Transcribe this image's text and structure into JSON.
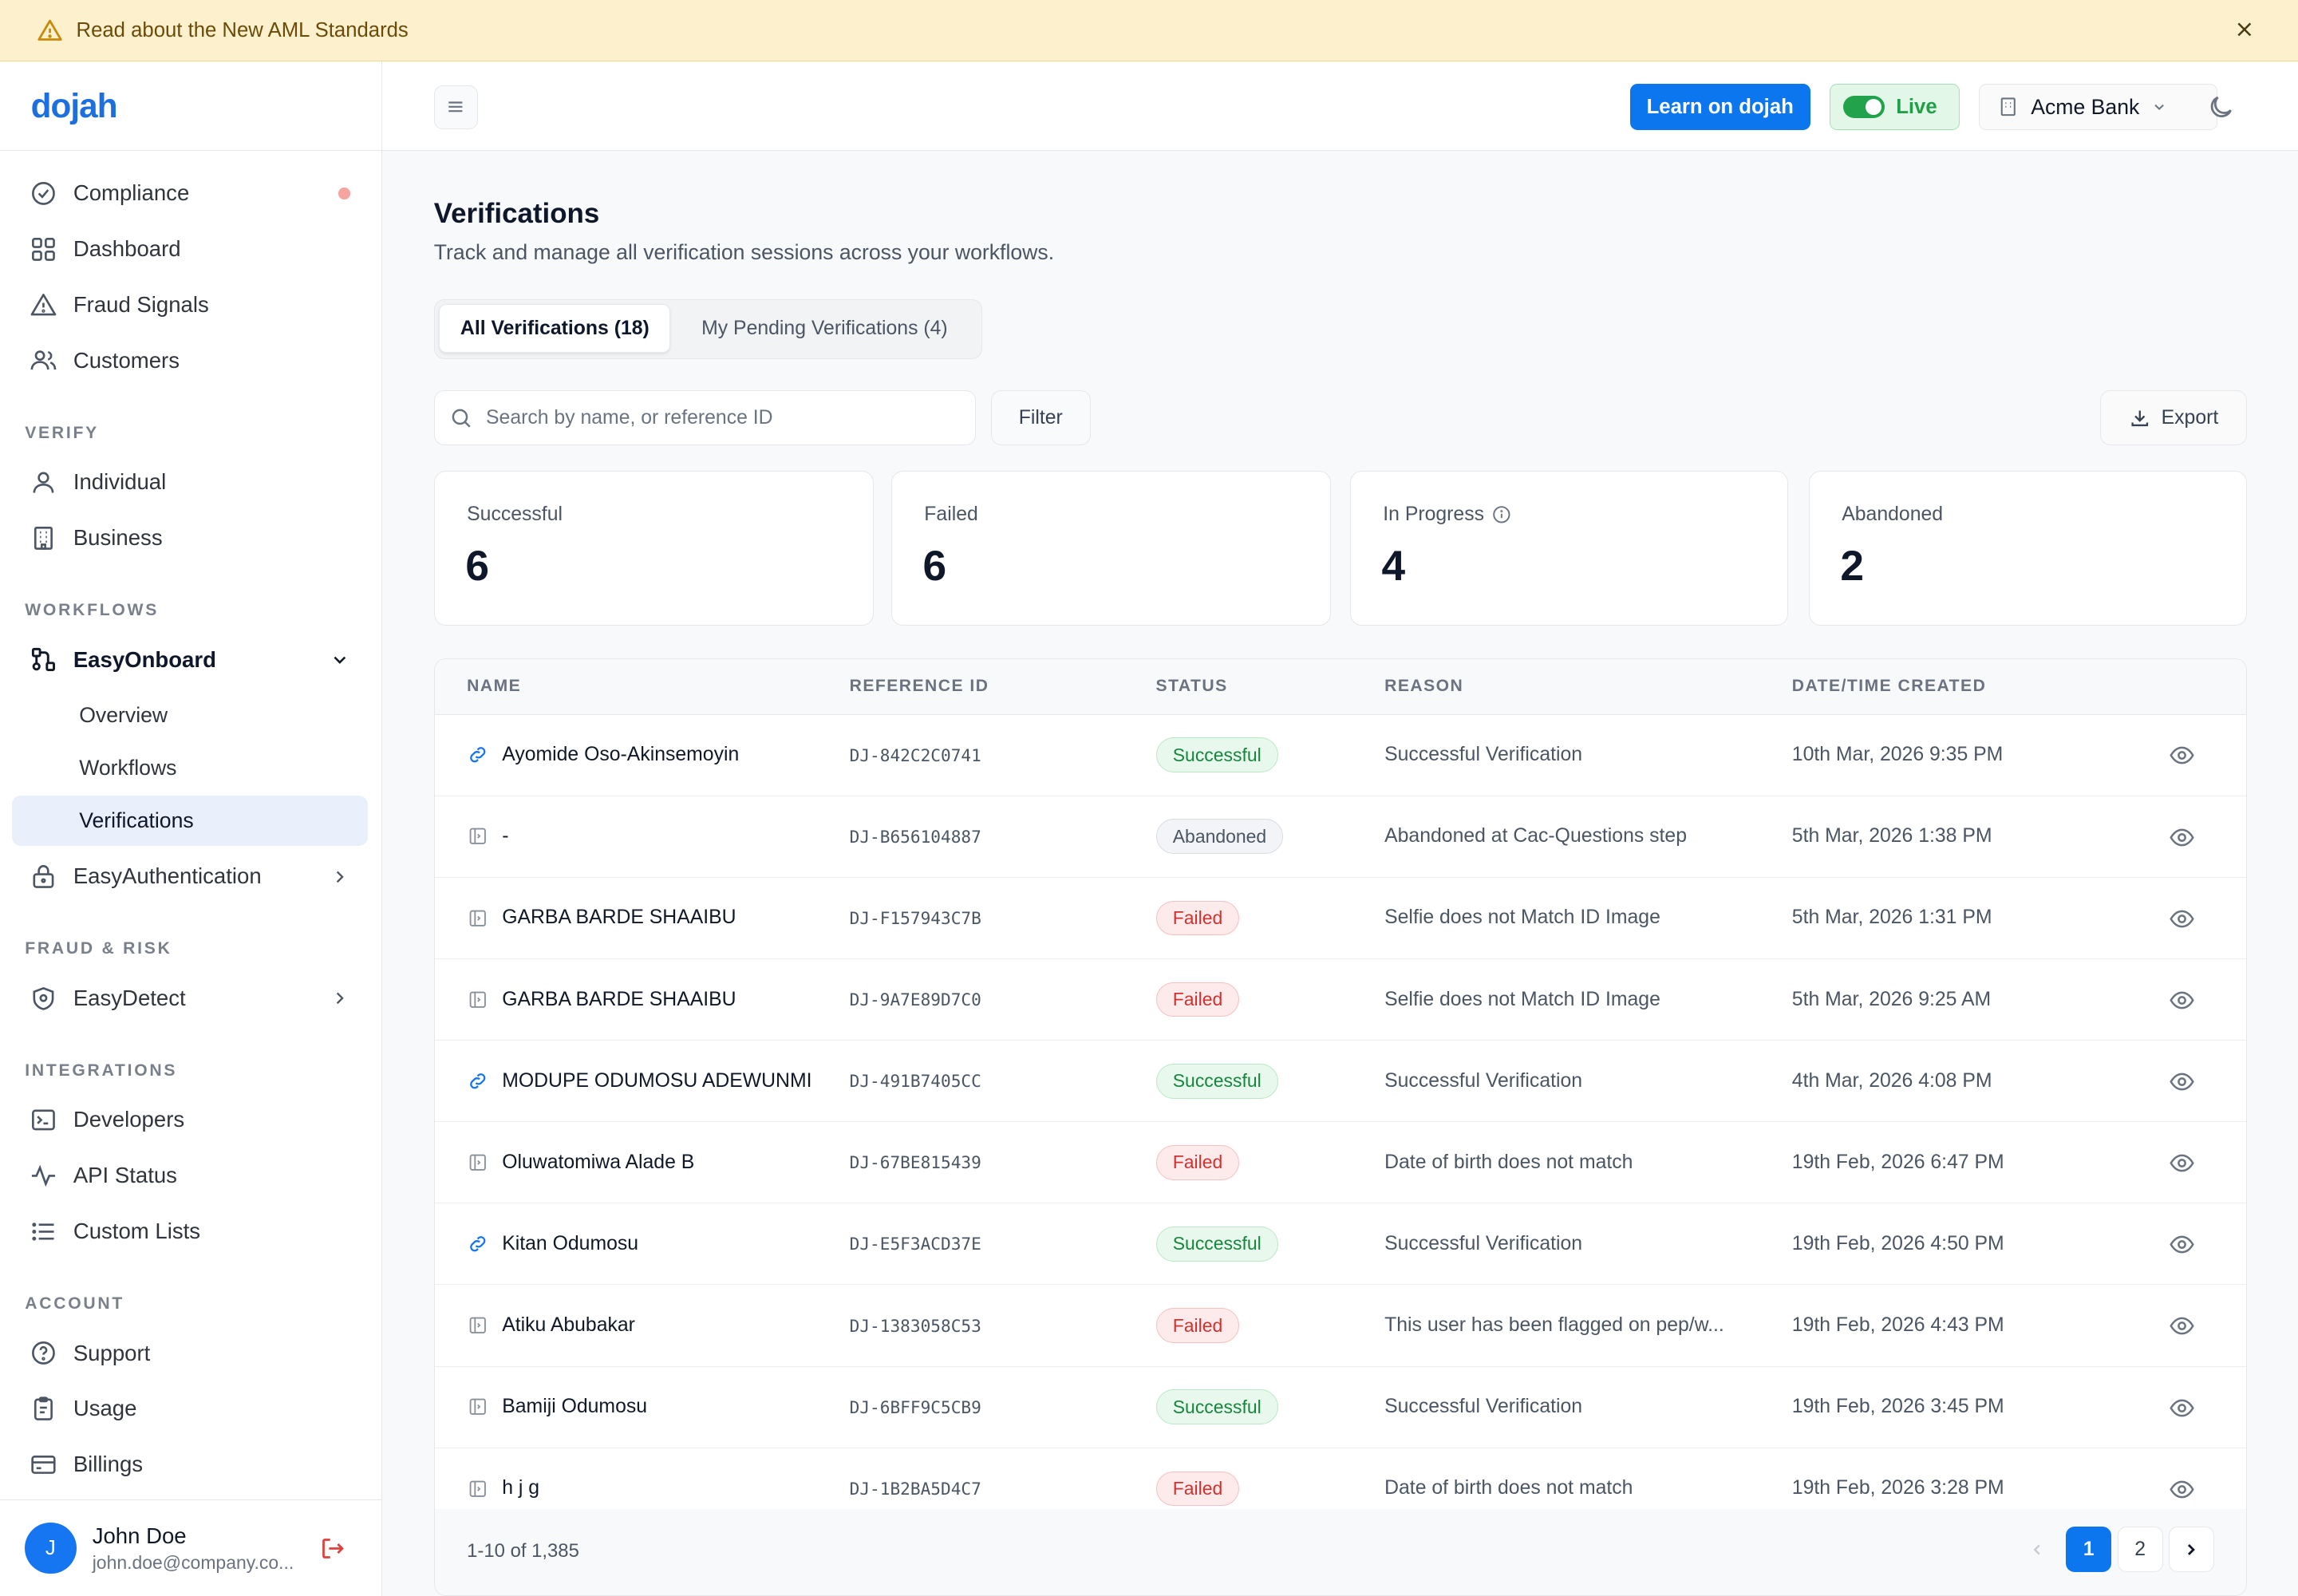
{
  "banner": {
    "text": "Read about the New AML Standards"
  },
  "brand": {
    "logo_text": "dojah"
  },
  "sidebar": {
    "top_items": [
      {
        "label": "Compliance",
        "icon": "check-circle-icon"
      },
      {
        "label": "Dashboard",
        "icon": "grid-icon"
      },
      {
        "label": "Fraud Signals",
        "icon": "warning-triangle-icon"
      },
      {
        "label": "Customers",
        "icon": "users-icon"
      }
    ],
    "sections": {
      "verify": "VERIFY",
      "workflows": "WORKFLOWS",
      "fraud": "FRAUD & RISK",
      "integrations": "INTEGRATIONS",
      "account": "ACCOUNT"
    },
    "verify_items": [
      {
        "label": "Individual",
        "icon": "user-icon"
      },
      {
        "label": "Business",
        "icon": "building-icon"
      }
    ],
    "easyonboard": {
      "label": "EasyOnboard",
      "sub": [
        "Overview",
        "Workflows",
        "Verifications"
      ]
    },
    "easyauth": {
      "label": "EasyAuthentication"
    },
    "easydetect": {
      "label": "EasyDetect"
    },
    "integration_items": [
      {
        "label": "Developers",
        "icon": "terminal-icon"
      },
      {
        "label": "API Status",
        "icon": "activity-icon"
      },
      {
        "label": "Custom Lists",
        "icon": "list-icon"
      }
    ],
    "account_items": [
      {
        "label": "Support",
        "icon": "help-circle-icon"
      },
      {
        "label": "Usage",
        "icon": "clipboard-icon"
      },
      {
        "label": "Billings",
        "icon": "credit-card-icon"
      }
    ],
    "user": {
      "initial": "J",
      "name": "John Doe",
      "email": "john.doe@company.co..."
    }
  },
  "topbar": {
    "learn_label": "Learn on dojah",
    "live_label": "Live",
    "org_label": "Acme Bank"
  },
  "page": {
    "title": "Verifications",
    "subtitle": "Track and manage all verification sessions across your workflows.",
    "tabs": [
      "All Verifications (18)",
      "My Pending Verifications (4)"
    ],
    "search_placeholder": "Search by name, or reference ID",
    "filter_label": "Filter",
    "export_label": "Export"
  },
  "stats": [
    {
      "label": "Successful",
      "value": "6"
    },
    {
      "label": "Failed",
      "value": "6"
    },
    {
      "label": "In Progress",
      "value": "4"
    },
    {
      "label": "Abandoned",
      "value": "2"
    }
  ],
  "table": {
    "headers": [
      "NAME",
      "REFERENCE ID",
      "STATUS",
      "REASON",
      "DATE/TIME CREATED"
    ],
    "rows": [
      {
        "icon": "link-icon",
        "name": "Ayomide Oso-Akinsemoyin",
        "ref": "DJ-842C2C0741",
        "status": "Successful",
        "reason": "Successful Verification",
        "date": "10th Mar, 2026 9:35 PM"
      },
      {
        "icon": "form-icon",
        "name": "-",
        "ref": "DJ-B656104887",
        "status": "Abandoned",
        "reason": "Abandoned at Cac-Questions step",
        "date": "5th Mar, 2026 1:38 PM"
      },
      {
        "icon": "form-icon",
        "name": "GARBA BARDE SHAAIBU",
        "ref": "DJ-F157943C7B",
        "status": "Failed",
        "reason": "Selfie does not Match ID Image",
        "date": "5th Mar, 2026 1:31 PM"
      },
      {
        "icon": "form-icon",
        "name": "GARBA BARDE SHAAIBU",
        "ref": "DJ-9A7E89D7C0",
        "status": "Failed",
        "reason": "Selfie does not Match ID Image",
        "date": "5th Mar, 2026 9:25 AM"
      },
      {
        "icon": "link-icon",
        "name": "MODUPE ODUMOSU ADEWUNMI",
        "ref": "DJ-491B7405CC",
        "status": "Successful",
        "reason": "Successful Verification",
        "date": "4th Mar, 2026 4:08 PM"
      },
      {
        "icon": "form-icon",
        "name": "Oluwatomiwa Alade B",
        "ref": "DJ-67BE815439",
        "status": "Failed",
        "reason": "Date of birth does not match",
        "date": "19th Feb, 2026 6:47 PM"
      },
      {
        "icon": "link-icon",
        "name": "Kitan Odumosu",
        "ref": "DJ-E5F3ACD37E",
        "status": "Successful",
        "reason": "Successful Verification",
        "date": "19th Feb, 2026 4:50 PM"
      },
      {
        "icon": "form-icon",
        "name": "Atiku Abubakar",
        "ref": "DJ-1383058C53",
        "status": "Failed",
        "reason": "This user has been flagged on pep/w...",
        "date": "19th Feb, 2026 4:43 PM"
      },
      {
        "icon": "form-icon",
        "name": "Bamiji Odumosu",
        "ref": "DJ-6BFF9C5CB9",
        "status": "Successful",
        "reason": "Successful Verification",
        "date": "19th Feb, 2026 3:45 PM"
      },
      {
        "icon": "form-icon",
        "name": "h j g",
        "ref": "DJ-1B2BA5D4C7",
        "status": "Failed",
        "reason": "Date of birth does not match",
        "date": "19th Feb, 2026 3:28 PM"
      }
    ]
  },
  "pagination": {
    "range": "1-10 of 1,385",
    "pages": [
      "1",
      "2"
    ],
    "current": "1"
  },
  "colors": {
    "accent": "#0b76ee",
    "success": "#16853d",
    "failed": "#d3312f",
    "banner_bg": "#fcf1cc"
  }
}
